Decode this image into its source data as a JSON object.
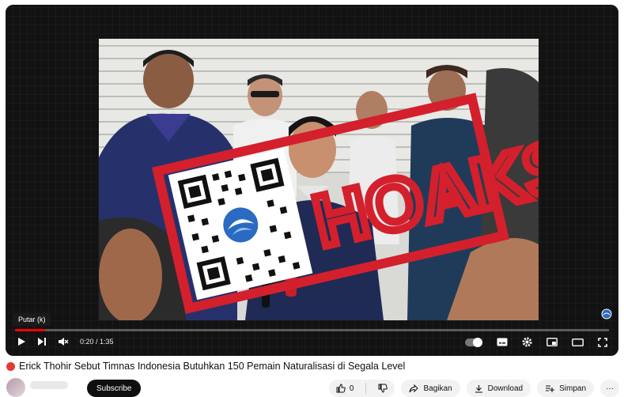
{
  "video": {
    "title": "Erick Thohir Sebut Timnas Indonesia Butuhkan 150 Pemain Naturalisasi di Segala Level",
    "stamp_text": "HOAKS",
    "tooltip": "Putar (k)",
    "time_display": "0:20 / 1:35",
    "progress_fraction": 0.05
  },
  "channel": {
    "subscribe_label": "Subscribe"
  },
  "actions": {
    "like_count": "0",
    "share_label": "Bagikan",
    "download_label": "Download",
    "save_label": "Simpan",
    "more_label": "···"
  },
  "colors": {
    "stamp_red": "#d3202c",
    "progress_red": "#ff0000"
  }
}
